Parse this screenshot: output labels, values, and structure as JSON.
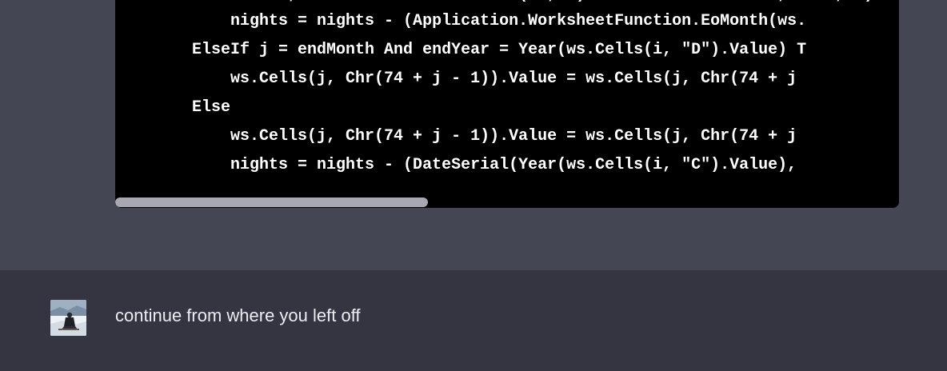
{
  "assistant_message": {
    "code_block": {
      "lines": [
        "            nights = nights - (Application.WorksheetFunction.EoMonth(ws.",
        "        ElseIf j = endMonth And endYear = Year(ws.Cells(i, \"D\").Value) T",
        "            ws.Cells(j, Chr(74 + j - 1)).Value = ws.Cells(j, Chr(74 + j ",
        "        Else",
        "            ws.Cells(j, Chr(74 + j - 1)).Value = ws.Cells(j, Chr(74 + j ",
        "            nights = nights - (DateSerial(Year(ws.Cells(i, \"C\").Value),"
      ],
      "horizontal_scroll_position": 0.0
    }
  },
  "user_message": {
    "avatar_icon": "user-avatar-icon",
    "text": "continue from where you left off"
  },
  "colors": {
    "assistant_background": "#444654",
    "user_background": "#343541",
    "code_background": "#000000",
    "code_text": "#ffffff",
    "scrollbar_thumb": "#a7a8b2"
  }
}
